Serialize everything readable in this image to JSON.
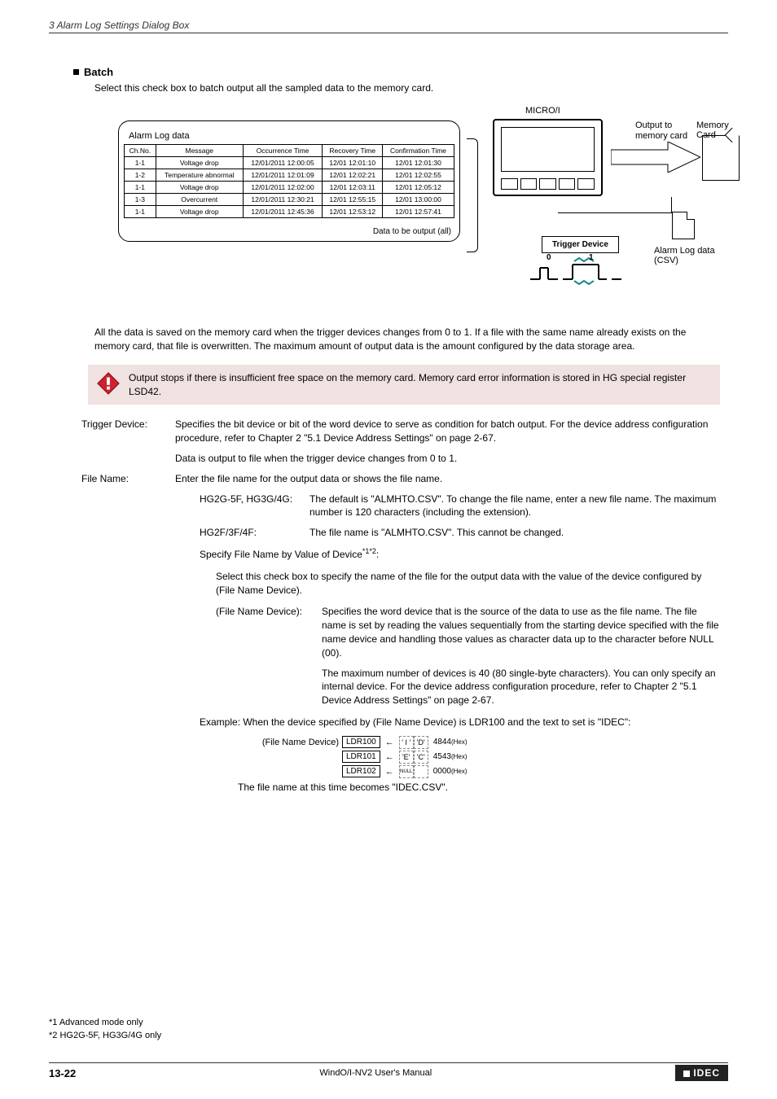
{
  "header": {
    "breadcrumb": "3 Alarm Log Settings Dialog Box"
  },
  "section": {
    "title": "Batch",
    "intro": "Select this check box to batch output all the sampled data to the memory card."
  },
  "diagram": {
    "microi": "MICRO/I",
    "alarm_caption": "Alarm Log data",
    "table": {
      "headers": [
        "Ch.No.",
        "Message",
        "Occurrence Time",
        "Recovery Time",
        "Confirmation Time"
      ],
      "rows": [
        [
          "1-1",
          "Voltage drop",
          "12/01/2011 12:00:05",
          "12/01 12:01:10",
          "12/01 12:01:30"
        ],
        [
          "1-2",
          "Temperature abnormal",
          "12/01/2011 12:01:09",
          "12/01 12:02:21",
          "12/01 12:02:55"
        ],
        [
          "1-1",
          "Voltage drop",
          "12/01/2011 12:02:00",
          "12/01 12:03:11",
          "12/01 12:05:12"
        ],
        [
          "1-3",
          "Overcurrent",
          "12/01/2011 12:30:21",
          "12/01 12:55:15",
          "12/01 13:00:00"
        ],
        [
          "1-1",
          "Voltage drop",
          "12/01/2011 12:45:36",
          "12/01 12:53:12",
          "12/01 12:57:41"
        ]
      ]
    },
    "data_label": "Data to be output (all)",
    "output_to": "Output to",
    "memory_card_line2": "memory card",
    "memory_card_label": "Memory Card",
    "trigger_device": "Trigger Device",
    "zero": "0",
    "one": "1",
    "csv_label": "Alarm Log data (CSV)"
  },
  "para1": "All the data is saved on the memory card when the trigger devices changes from 0 to 1. If a file with the same name already exists on the memory card, that file is overwritten. The maximum amount of output data is the amount configured by the data storage area.",
  "warn": "Output stops if there is insufficient free space on the memory card. Memory card error information is stored in HG special register LSD42.",
  "defs": {
    "trigger_label": "Trigger Device:",
    "trigger_body": "Specifies the bit device or bit of the word device to serve as condition for batch output. For the device address configuration procedure, refer to Chapter 2 \"5.1 Device Address Settings\" on page 2-67.",
    "trigger_body2": "Data is output to file when the trigger device changes from 0 to 1.",
    "file_label": "File Name:",
    "file_body": "Enter the file name for the output data or shows the file name.",
    "hg2g_label": "HG2G-5F, HG3G/4G:",
    "hg2g_body": "The default is \"ALMHTO.CSV\". To change the file name, enter a new file name. The maximum number is 120 characters (including the extension).",
    "hg2f_label": "HG2F/3F/4F:",
    "hg2f_body": "The file name is \"ALMHTO.CSV\". This cannot be changed.",
    "specify_heading": "Specify File Name by Value of Device",
    "specify_sup": "*1*2",
    "specify_colon": ":",
    "specify_body": "Select this check box to specify the name of the file for the output data with the value of the device configured by (File Name Device).",
    "fnd_label": "(File Name Device):",
    "fnd_body1": "Specifies the word device that is the source of the data to use as the file name. The file name is set by reading the values sequentially from the starting device specified with the file name device and handling those values as character data up to the character before NULL (00).",
    "fnd_body2": "The maximum number of devices is 40 (80 single-byte characters). You can only specify an internal device. For the device address configuration procedure, refer to Chapter 2 \"5.1 Device Address Settings\" on page 2-67.",
    "example_lead": "Example: When the device specified by (File Name Device) is LDR100 and the text to set is \"IDEC\":",
    "ldr": {
      "fnd_caption": "(File Name Device)",
      "rows": [
        {
          "dev": "LDR100",
          "c1": "' I '",
          "c2": "'D'",
          "hex": "4844",
          "hx": "(Hex)"
        },
        {
          "dev": "LDR101",
          "c1": "'E'",
          "c2": "'C'",
          "hex": "4543",
          "hx": "(Hex)"
        },
        {
          "dev": "LDR102",
          "c1": "NULL",
          "c2": "",
          "hex": "0000",
          "hx": "(Hex)"
        }
      ],
      "result": "The file name at this time becomes \"IDEC.CSV\"."
    }
  },
  "footnotes": {
    "f1": "*1 Advanced mode only",
    "f2": "*2 HG2G-5F, HG3G/4G only"
  },
  "footer": {
    "page": "13-22",
    "center": "WindO/I-NV2 User's Manual",
    "brand": "IDEC"
  }
}
